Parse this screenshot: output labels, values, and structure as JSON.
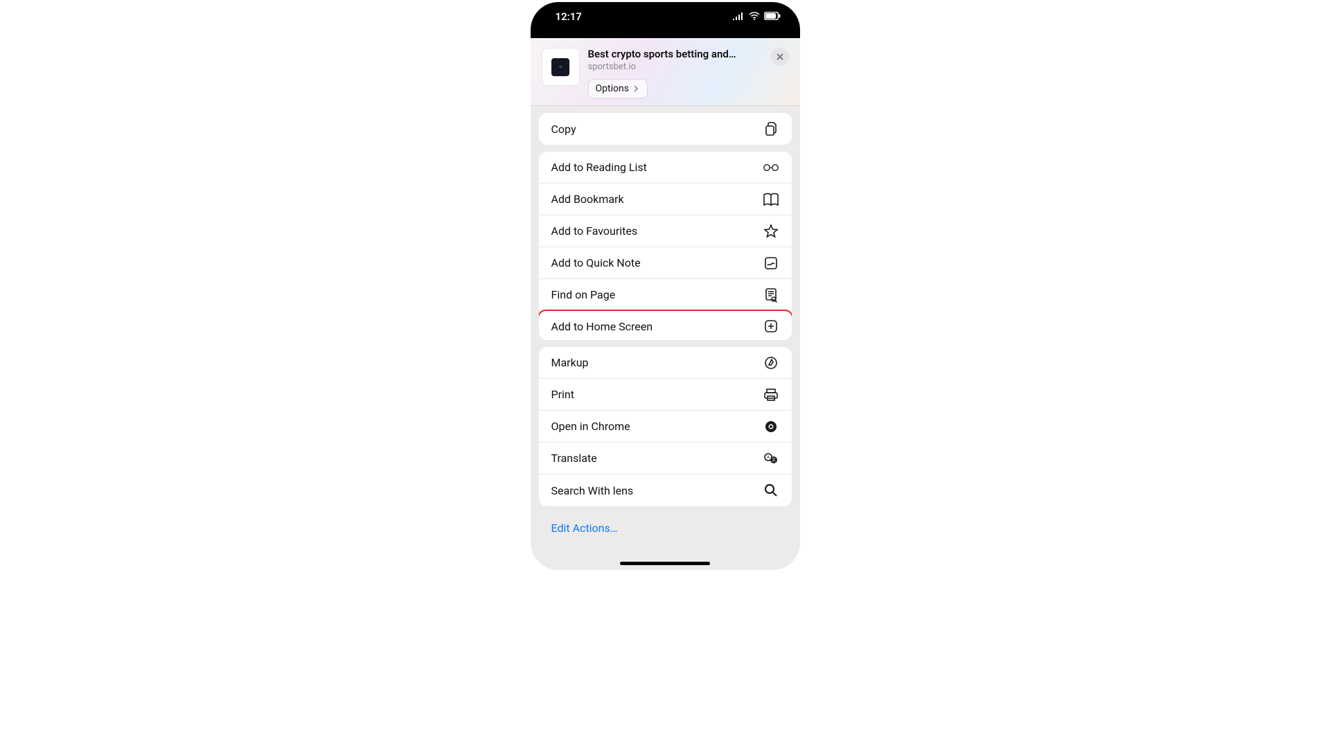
{
  "status": {
    "time": "12:17"
  },
  "header": {
    "title": "Best crypto sports betting and…",
    "subtitle": "sportsbet.io",
    "options_label": "Options"
  },
  "groups": [
    [
      {
        "label": "Copy",
        "icon": "copy-icon"
      }
    ],
    [
      {
        "label": "Add to Reading List",
        "icon": "glasses-icon"
      },
      {
        "label": "Add Bookmark",
        "icon": "book-icon"
      },
      {
        "label": "Add to Favourites",
        "icon": "star-icon"
      },
      {
        "label": "Add to Quick Note",
        "icon": "note-icon"
      },
      {
        "label": "Find on Page",
        "icon": "doc-search-icon"
      },
      {
        "label": "Add to Home Screen",
        "icon": "plus-square-icon",
        "highlight": true
      }
    ],
    [
      {
        "label": "Markup",
        "icon": "markup-icon"
      },
      {
        "label": "Print",
        "icon": "print-icon"
      },
      {
        "label": "Open in Chrome",
        "icon": "chrome-icon"
      },
      {
        "label": "Translate",
        "icon": "translate-icon"
      },
      {
        "label": "Search With lens",
        "icon": "search-icon"
      }
    ]
  ],
  "edit_label": "Edit Actions…"
}
